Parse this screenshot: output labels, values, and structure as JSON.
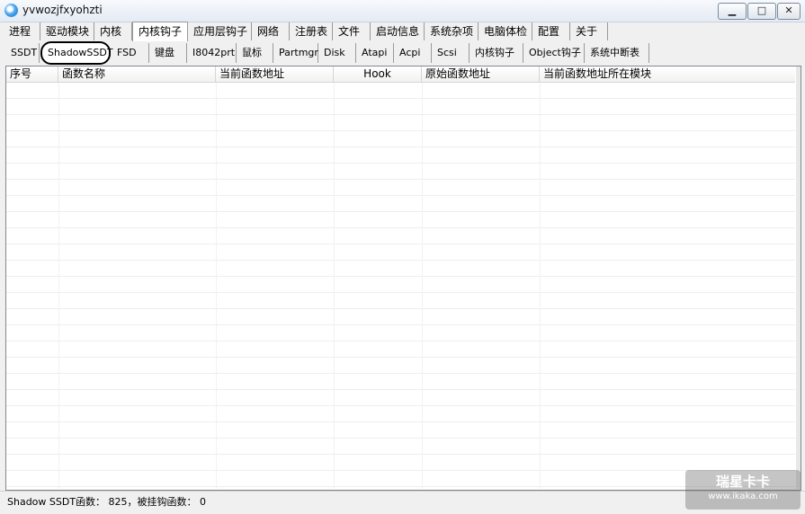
{
  "window": {
    "title": "yvwozjfxyohzti",
    "min_symbol": "▁",
    "max_symbol": "□",
    "close_symbol": "✕"
  },
  "main_tabs": [
    "进程",
    "驱动模块",
    "内核",
    "内核钩子",
    "应用层钩子",
    "网络",
    "注册表",
    "文件",
    "启动信息",
    "系统杂项",
    "电脑体检",
    "配置",
    "关于"
  ],
  "sub_tabs": [
    "SSDT",
    "ShadowSSDT",
    "FSD",
    "键盘",
    "I8042prt",
    "鼠标",
    "Partmgr",
    "Disk",
    "Atapi",
    "Acpi",
    "Scsi",
    "内核钩子",
    "Object钩子",
    "系统中断表"
  ],
  "table": {
    "columns": [
      "序号",
      "函数名称",
      "当前函数地址",
      "Hook",
      "原始函数地址",
      "当前函数地址所在模块"
    ]
  },
  "status": "Shadow SSDT函数： 825，被挂钩函数： 0",
  "watermark": {
    "title": "瑞星卡卡",
    "url": "www.ikaka.com"
  }
}
